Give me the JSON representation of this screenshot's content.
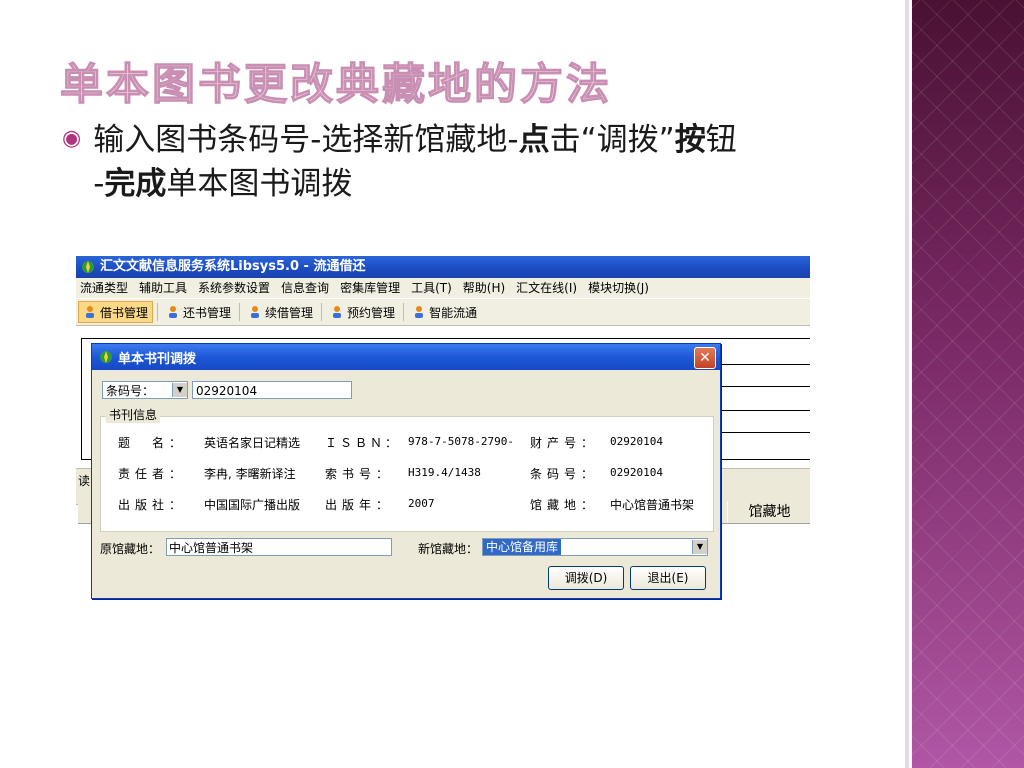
{
  "slide": {
    "title": "单本图书更改典藏地的方法",
    "bullet": {
      "p1": "输入图书条码号-选择新馆藏地-",
      "b1": "点",
      "p2": "击“调拨”",
      "b2": "按",
      "p3": "钮",
      "p4": "-",
      "b3": "完成",
      "p5": "单本图书调拨"
    }
  },
  "app": {
    "title": "汇文文献信息服务系统Libsys5.0 - 流通借还",
    "menu": [
      "流通类型",
      "辅助工具",
      "系统参数设置",
      "信息查询",
      "密集库管理",
      "工具(T)",
      "帮助(H)",
      "汇文在线(I)",
      "模块切换(J)"
    ],
    "toolbar": [
      "借书管理",
      "还书管理",
      "续借管理",
      "预约管理",
      "智能流通"
    ],
    "reader_label": "读",
    "column_header": "馆藏地"
  },
  "dialog": {
    "title": "单本书刊调拨",
    "close": "✕",
    "barcode_type": "条码号：",
    "barcode_value": "02920104",
    "group_title": "书刊信息",
    "fields": [
      {
        "label": "题　名：",
        "value": "英语名家日记精选"
      },
      {
        "label": "ＩＳＢＮ：",
        "value": "978-7-5078-2790-"
      },
      {
        "label": "财产号：",
        "value": "02920104"
      },
      {
        "label": "责任者：",
        "value": "李冉, 李曙新译注"
      },
      {
        "label": "索书号：",
        "value": "H319.4/1438"
      },
      {
        "label": "条码号：",
        "value": "02920104"
      },
      {
        "label": "出版社：",
        "value": "中国国际广播出版"
      },
      {
        "label": "出版年：",
        "value": "2007"
      },
      {
        "label": "馆藏地：",
        "value": "中心馆普通书架"
      }
    ],
    "orig_location_label": "原馆藏地：",
    "orig_location_value": "中心馆普通书架",
    "new_location_label": "新馆藏地：",
    "new_location_value": "中心馆备用库",
    "transfer_button": "调拨(D)",
    "exit_button": "退出(E)"
  },
  "colors": {
    "title_accent": "#f0cbe0",
    "bullet_accent": "#b0357e",
    "xp_titlebar": "#1d58d8",
    "toolbar_active": "#fcd987"
  }
}
